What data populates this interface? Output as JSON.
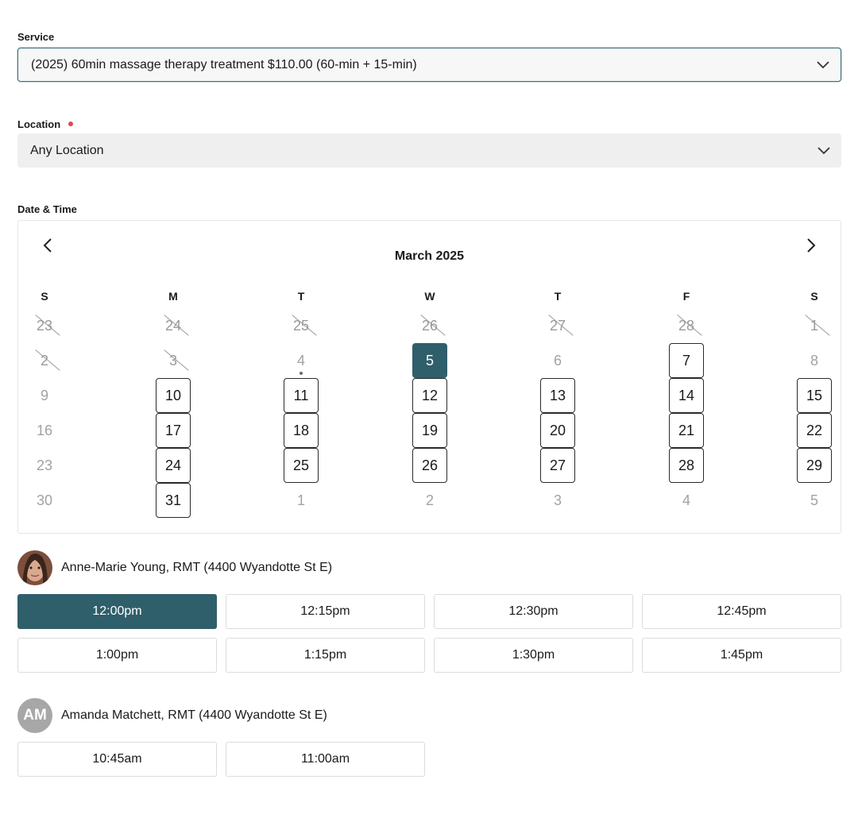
{
  "service": {
    "label": "Service",
    "value": "(2025) 60min massage therapy treatment $110.00 (60-min + 15-min)"
  },
  "location": {
    "label": "Location",
    "value": "Any Location"
  },
  "datetime": {
    "label": "Date & Time",
    "month_title": "March 2025",
    "weekdays": [
      "S",
      "M",
      "T",
      "W",
      "T",
      "F",
      "S"
    ],
    "weeks": [
      [
        {
          "d": "23",
          "s": "strike"
        },
        {
          "d": "24",
          "s": "strike"
        },
        {
          "d": "25",
          "s": "strike"
        },
        {
          "d": "26",
          "s": "strike"
        },
        {
          "d": "27",
          "s": "strike"
        },
        {
          "d": "28",
          "s": "strike"
        },
        {
          "d": "1",
          "s": "strike"
        }
      ],
      [
        {
          "d": "2",
          "s": "strike"
        },
        {
          "d": "3",
          "s": "strike"
        },
        {
          "d": "4",
          "s": "today"
        },
        {
          "d": "5",
          "s": "selected"
        },
        {
          "d": "6",
          "s": "muted"
        },
        {
          "d": "7",
          "s": "avail"
        },
        {
          "d": "8",
          "s": "muted"
        }
      ],
      [
        {
          "d": "9",
          "s": "muted"
        },
        {
          "d": "10",
          "s": "avail"
        },
        {
          "d": "11",
          "s": "avail"
        },
        {
          "d": "12",
          "s": "avail"
        },
        {
          "d": "13",
          "s": "avail"
        },
        {
          "d": "14",
          "s": "avail"
        },
        {
          "d": "15",
          "s": "avail"
        }
      ],
      [
        {
          "d": "16",
          "s": "muted"
        },
        {
          "d": "17",
          "s": "avail"
        },
        {
          "d": "18",
          "s": "avail"
        },
        {
          "d": "19",
          "s": "avail"
        },
        {
          "d": "20",
          "s": "avail"
        },
        {
          "d": "21",
          "s": "avail"
        },
        {
          "d": "22",
          "s": "avail"
        }
      ],
      [
        {
          "d": "23",
          "s": "muted"
        },
        {
          "d": "24",
          "s": "avail"
        },
        {
          "d": "25",
          "s": "avail"
        },
        {
          "d": "26",
          "s": "avail"
        },
        {
          "d": "27",
          "s": "avail"
        },
        {
          "d": "28",
          "s": "avail"
        },
        {
          "d": "29",
          "s": "avail"
        }
      ],
      [
        {
          "d": "30",
          "s": "muted"
        },
        {
          "d": "31",
          "s": "avail"
        },
        {
          "d": "1",
          "s": "muted"
        },
        {
          "d": "2",
          "s": "muted"
        },
        {
          "d": "3",
          "s": "muted"
        },
        {
          "d": "4",
          "s": "muted"
        },
        {
          "d": "5",
          "s": "muted"
        }
      ]
    ]
  },
  "providers": [
    {
      "name": "Anne-Marie Young, RMT (4400 Wyandotte St E)",
      "avatar": "photo",
      "slots": [
        "12:00pm",
        "12:15pm",
        "12:30pm",
        "12:45pm",
        "1:00pm",
        "1:15pm",
        "1:30pm",
        "1:45pm"
      ],
      "selected_slot": "12:00pm"
    },
    {
      "name": "Amanda Matchett, RMT (4400 Wyandotte St E)",
      "avatar": "initials",
      "initials": "AM",
      "slots": [
        "10:45am",
        "11:00am"
      ]
    }
  ],
  "icons": {
    "dropdown": "chevron-down-icon",
    "prev": "chevron-left-icon",
    "next": "chevron-right-icon"
  },
  "colors": {
    "accent": "#2f5f6b",
    "required": "#e04848"
  }
}
